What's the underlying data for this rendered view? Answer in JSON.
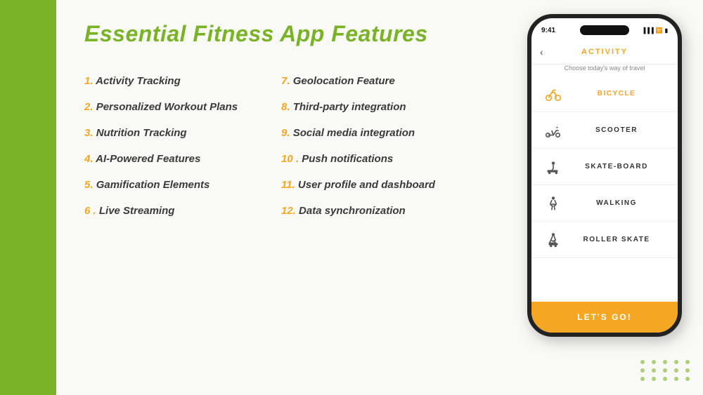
{
  "page": {
    "title": "Essential Fitness App Features",
    "background_color": "#f9f9f5",
    "accent_color": "#7ab328",
    "orange_color": "#f5a623"
  },
  "features": {
    "left_column": [
      {
        "number": "1.",
        "text": "Activity Tracking"
      },
      {
        "number": "2.",
        "text": "Personalized Workout Plans"
      },
      {
        "number": "3.",
        "text": "Nutrition Tracking"
      },
      {
        "number": "4.",
        "text": "AI-Powered Features"
      },
      {
        "number": "5.",
        "text": "Gamification Elements"
      },
      {
        "number": "6 .",
        "text": "Live Streaming"
      }
    ],
    "right_column": [
      {
        "number": "7.",
        "text": "Geolocation Feature"
      },
      {
        "number": "8.",
        "text": "Third-party integration"
      },
      {
        "number": "9.",
        "text": "Social media integration"
      },
      {
        "number": "10 .",
        "text": "Push notifications"
      },
      {
        "number": "11.",
        "text": "User profile and dashboard"
      },
      {
        "number": "12.",
        "text": "Data synchronization"
      }
    ]
  },
  "phone": {
    "time": "9:41",
    "header_title": "ACTIVITY",
    "subtitle": "Choose today's way of travel",
    "cta_label": "LET'S GO!",
    "transport_items": [
      {
        "label": "BICYCLE",
        "icon": "bicycle",
        "active": true
      },
      {
        "label": "SCOOTER",
        "icon": "scooter",
        "active": false
      },
      {
        "label": "SKATE-BOARD",
        "icon": "skateboard",
        "active": false
      },
      {
        "label": "WALKING",
        "icon": "walking",
        "active": false
      },
      {
        "label": "ROLLER SKATE",
        "icon": "rollerskate",
        "active": false
      }
    ]
  },
  "dots": {
    "rows": 3,
    "cols": 5
  }
}
